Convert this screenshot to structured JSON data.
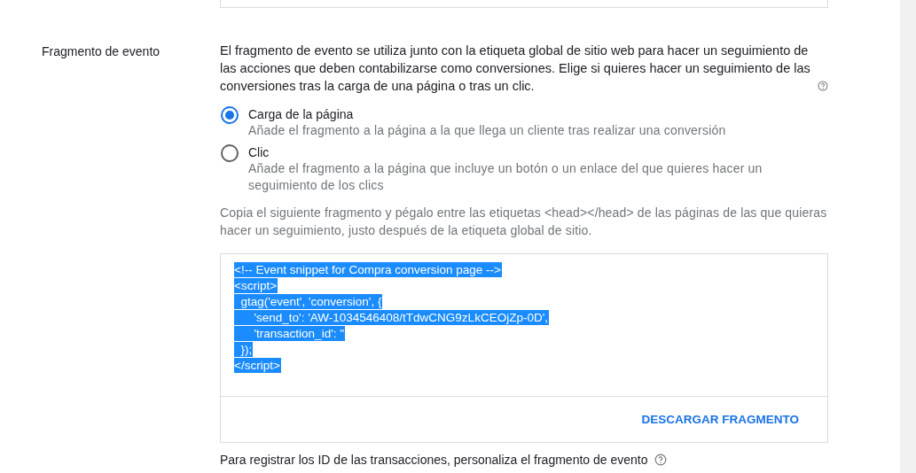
{
  "section": {
    "label": "Fragmento de evento",
    "description": "El fragmento de evento se utiliza junto con la etiqueta global de sitio web para hacer un seguimiento de las acciones que deben contabilizarse como conversiones. Elige si quieres hacer un seguimiento de las conversiones tras la carga de una página o tras un clic.",
    "options": [
      {
        "title": "Carga de la página",
        "hint": "Añade el fragmento a la página a la que llega un cliente tras realizar una conversión",
        "selected": true
      },
      {
        "title": "Clic",
        "hint": "Añade el fragmento a la página que incluye un botón o un enlace del que quieres hacer un seguimiento de los clics",
        "selected": false
      }
    ],
    "instructions": "Copia el siguiente fragmento y pégalo entre las etiquetas <head></head> de las páginas de las que quieras hacer un seguimiento, justo después de la etiqueta global de sitio.",
    "code": {
      "selected": true,
      "lines": [
        "<!-- Event snippet for Compra conversion page -->",
        "<script>",
        "  gtag('event', 'conversion', {",
        "      'send_to': 'AW-1034546408/tTdwCNG9zLkCEOjZp-0D',",
        "      'transaction_id': ''",
        "  });",
        "</script>"
      ]
    },
    "download_button": "DESCARGAR FRAGMENTO",
    "footer_note": "Para registrar los ID de las transacciones, personaliza el fragmento de evento"
  }
}
